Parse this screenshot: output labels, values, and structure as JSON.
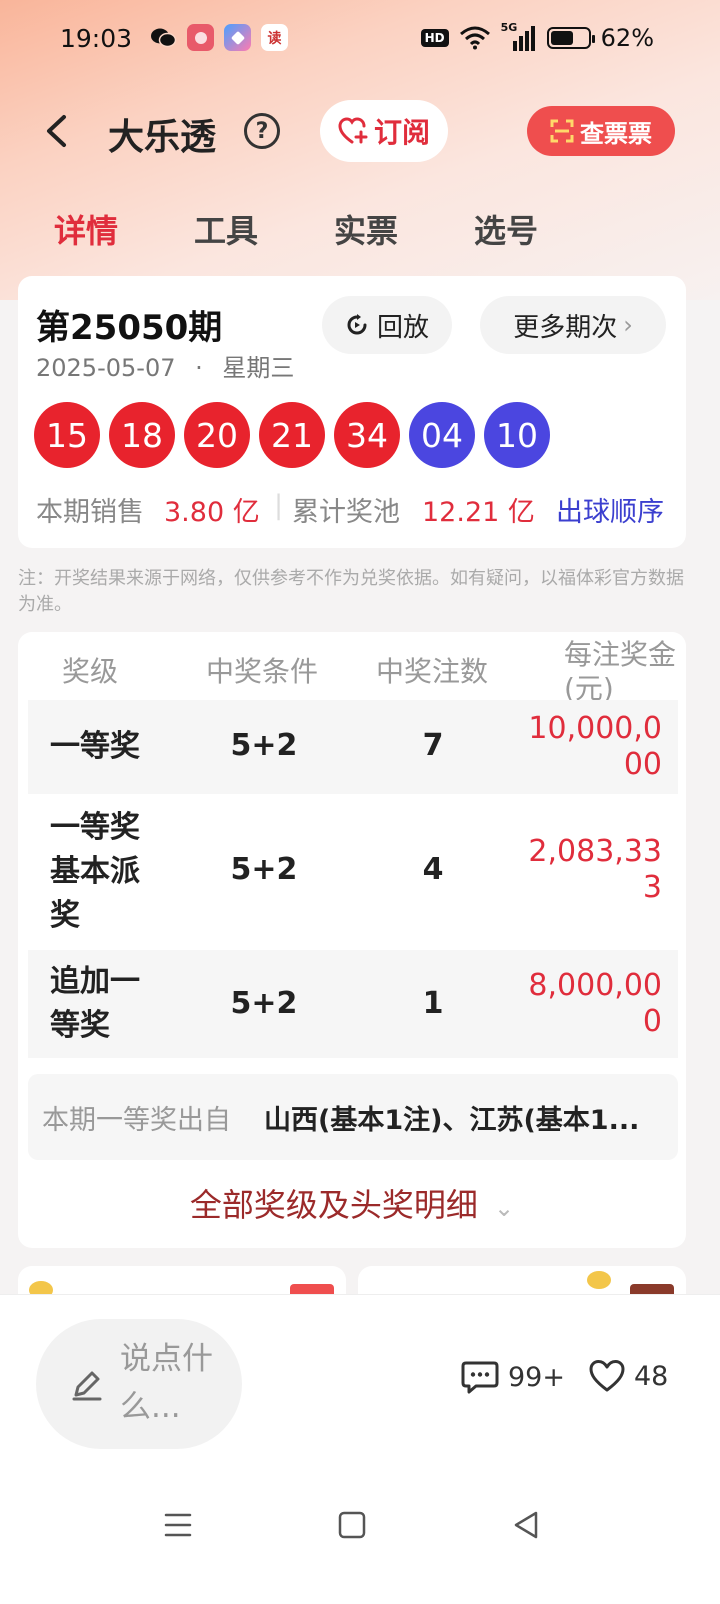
{
  "status_bar": {
    "time": "19:03",
    "battery_text": "62%",
    "battery_level": 0.62,
    "hd_label": "HD",
    "network_label": "5G",
    "app_icons": [
      "wechat-icon",
      "photos-icon",
      "app-icon",
      "reader-icon"
    ],
    "reader_icon_text": "读"
  },
  "header": {
    "title": "大乐透",
    "help_symbol": "?",
    "subscribe_label": "订阅",
    "check_ticket_label": "查票票"
  },
  "tabs": [
    "详情",
    "工具",
    "实票",
    "选号"
  ],
  "draw": {
    "issue": "第25050期",
    "date": "2025-05-07",
    "separator": "·",
    "weekday": "星期三",
    "replay_label": "回放",
    "more_label": "更多期次",
    "more_chevron": "›",
    "red_balls": [
      "15",
      "18",
      "20",
      "21",
      "34"
    ],
    "blue_balls": [
      "04",
      "10"
    ],
    "sales_label": "本期销售",
    "sales_value": "3.80 亿",
    "stat_divider": "|",
    "pool_label": "累计奖池",
    "pool_value": "12.21 亿",
    "order_link": "出球顺序"
  },
  "colors": {
    "red_ball": "#e8232d",
    "blue_ball": "#4b46e0",
    "accent_red": "#e02d3c",
    "link_blue": "#3b3fcf"
  },
  "note": "注：开奖结果来源于网络，仅供参考不作为兑奖依据。如有疑问，以福体彩官方数据为准。",
  "prize_table": {
    "headers": {
      "level": "奖级",
      "condition": "中奖条件",
      "count": "中奖注数",
      "amount": "每注奖金(元)"
    },
    "rows": [
      {
        "level": "一等奖",
        "condition": "5+2",
        "count": "7",
        "amount": "10,000,000"
      },
      {
        "level": "一等奖基本派奖",
        "condition": "5+2",
        "count": "4",
        "amount": "2,083,333"
      },
      {
        "level": "追加一等奖",
        "condition": "5+2",
        "count": "1",
        "amount": "8,000,000"
      }
    ],
    "origin_label": "本期一等奖出自",
    "origin_value": "山西(基本1注)、江苏(基本1...",
    "all_levels_label": "全部奖级及头奖明细",
    "all_levels_chevron": "⌄"
  },
  "bottom_bar": {
    "comment_placeholder": "说点什么...",
    "comment_count": "99+",
    "like_count": "48"
  }
}
